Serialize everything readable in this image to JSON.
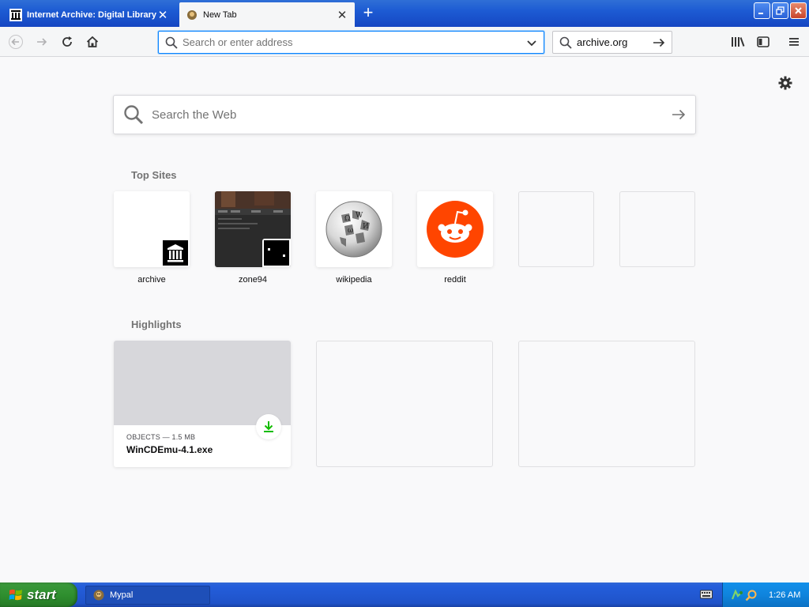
{
  "browser": {
    "tabs": [
      {
        "title": "Internet Archive: Digital Library of",
        "active": false
      },
      {
        "title": "New Tab",
        "active": true
      }
    ],
    "urlbar": {
      "placeholder": "Search or enter address",
      "value": ""
    },
    "searchbar": {
      "engine": "archive.org"
    }
  },
  "newtab": {
    "search_placeholder": "Search the Web",
    "top_sites_title": "Top Sites",
    "top_sites": [
      {
        "label": "archive"
      },
      {
        "label": "zone94"
      },
      {
        "label": "wikipedia"
      },
      {
        "label": "reddit"
      },
      {
        "label": ""
      },
      {
        "label": ""
      }
    ],
    "highlights_title": "Highlights",
    "highlights": [
      {
        "context": "OBJECTS — 1.5 MB",
        "title": "WinCDEmu-4.1.exe"
      }
    ]
  },
  "taskbar": {
    "start_label": "start",
    "tasks": [
      {
        "label": "Mypal"
      }
    ],
    "clock": "1:26 AM"
  },
  "colors": {
    "accent": "#0a84ff",
    "reddit": "#ff4500",
    "download": "#12bc00",
    "xp_taskbar": "#245edb",
    "xp_start": "#2f8f2f"
  }
}
